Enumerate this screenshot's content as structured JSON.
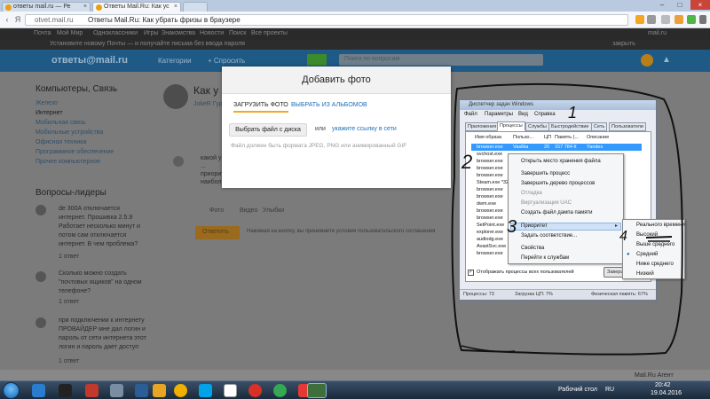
{
  "browser": {
    "tabs": [
      {
        "label": "ответы mail.ru — Ре"
      },
      {
        "label": "Ответы Mail.Ru: Как ус"
      },
      {
        "label": ""
      }
    ],
    "url_host": "otvet.mail.ru",
    "page_title": "Ответы Mail.Ru: Как убрать фризы в браузере",
    "reload_icon": "reload-icon",
    "yandex_icon": "yandex-icon"
  },
  "site": {
    "topnav_items": [
      "Почта",
      "Мой Мир",
      "Одноклассники",
      "Игры",
      "Знакомства",
      "Новости",
      "Поиск",
      "Все проекты"
    ],
    "topnav_right": "mail.ru",
    "notif_text": "Установите новому Почты — и получайте письма без ввода пароля",
    "notif_close": "закрыть",
    "logo": "ответы@mail.ru",
    "categories_label": "Категории",
    "ask_label": "+ Спросить",
    "search_placeholder": "Поиск по вопросам",
    "side_heading": "Компьютеры, Связь",
    "side_links": [
      "Железо",
      "Интернет",
      "Мобильная связь",
      "Мобильные устройства",
      "Офисная техника",
      "Программное обеспечение",
      "Прочее компьютерное"
    ],
    "leaders_heading": "Вопросы-лидеры",
    "leaders": [
      {
        "text": "de 300А отключается интернет. Прошивка 2.5.9 Работает несколько минут и потом сам отключается интернет. В чем проблема?",
        "meta": "1 ответ"
      },
      {
        "text": "Сколько можно создать \"почтовых ящиков\" на одном телефоне?",
        "meta": "1 ответ"
      },
      {
        "text": "при подключении к интернету ПРОВАЙДЕР мне дал логин и пароль от сети интернета этот логин и пароль дает доступ",
        "meta": "1 ответ"
      }
    ],
    "question_title_partial": "Как у",
    "author_partial": "JokeR Гуру",
    "answer_partial": "какой у ... приорит... наибол...",
    "like_label": "Фото",
    "video_label": "Видео",
    "smile_label": "Улыбки",
    "reply_button": "Ответить",
    "terms_text": "Нажимая на кнопку, вы принимаете условия пользовательского соглашения",
    "agent_label": "Mail.Ru Агент"
  },
  "modal": {
    "title": "Добавить фото",
    "tab_upload": "ЗАГРУЗИТЬ ФОТО",
    "tab_album": "ВЫБРАТЬ ИЗ АЛЬБОМОВ",
    "choose_file_button": "Выбрать файл с диска",
    "or_text": "или",
    "link_text": "укажите ссылку в сети",
    "hint": "Файл должен быть формата JPEG, PNG или анимированный GIF"
  },
  "taskmgr": {
    "title": "Диспетчер задач Windows",
    "menu": [
      "Файл",
      "Параметры",
      "Вид",
      "Справка"
    ],
    "tabs": [
      "Приложения",
      "Процессы",
      "Службы",
      "Быстродействие",
      "Сеть",
      "Пользователи"
    ],
    "columns": [
      "Имя образа",
      "Пользо...",
      "ЦП",
      "Память (...",
      "Описание"
    ],
    "rows": [
      "browser.exe",
      "svchost.exe",
      "browser.exe",
      "browser.exe",
      "browser.exe",
      "Steam.exe *32",
      "browser.exe",
      "browser.exe",
      "dwm.exe",
      "browser.exe",
      "browser.exe",
      "SetPoint.exe",
      "explorer.exe",
      "audiodg.exe",
      "AvastSvc.exe",
      "browser.exe"
    ],
    "first_row_values": [
      "Vasilka",
      "20",
      "157 784 К",
      "Yandex"
    ],
    "show_all_checkbox": "Отображать процессы всех пользователей",
    "end_button": "Завершить процесс",
    "status": {
      "processes": "Процессы: 73",
      "cpu": "Загрузка ЦП: 7%",
      "memory": "Физическая память: 67%"
    }
  },
  "context_menu": {
    "items": [
      {
        "label": "Открыть место хранения файла",
        "disabled": false
      },
      {
        "label": "Завершить процесс",
        "disabled": false
      },
      {
        "label": "Завершить дерево процессов",
        "disabled": false
      },
      {
        "label": "Отладка",
        "disabled": true
      },
      {
        "label": "Виртуализация UAC",
        "disabled": true
      },
      {
        "label": "Создать файл дампа памяти",
        "disabled": false
      },
      {
        "label": "Приоритет",
        "disabled": false
      },
      {
        "label": "Задать соответствие...",
        "disabled": false
      },
      {
        "label": "Свойства",
        "disabled": false
      },
      {
        "label": "Перейти к службам",
        "disabled": false
      }
    ]
  },
  "priority_menu": {
    "items": [
      "Реального времени",
      "Высокий",
      "Выше среднего",
      "Средний",
      "Ниже среднего",
      "Низкий"
    ],
    "selected": "Средний"
  },
  "annotations": [
    "1",
    "2",
    "3",
    "4"
  ],
  "taskbar": {
    "desktop_label": "Рабочий стол",
    "lang": "RU",
    "time": "20:42",
    "date": "19.04.2016"
  }
}
